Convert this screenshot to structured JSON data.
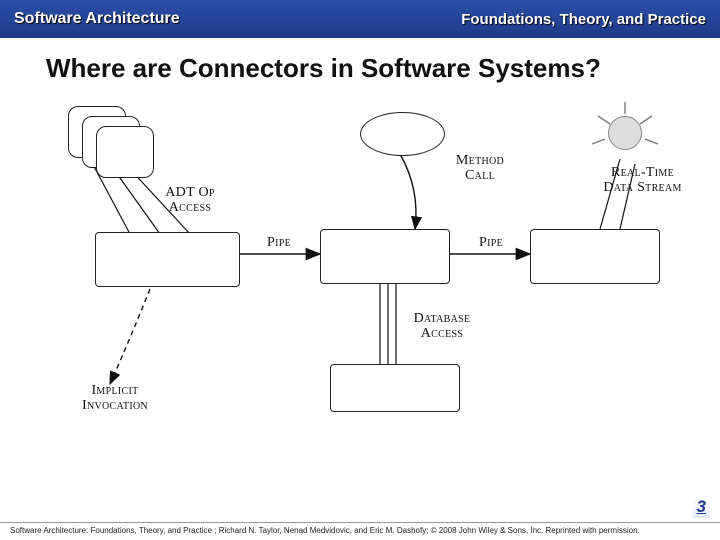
{
  "header": {
    "left": "Software Architecture",
    "right": "Foundations, Theory, and Practice"
  },
  "title": "Where are Connectors in Software Systems?",
  "labels": {
    "adt": "ADT Op Access",
    "pipe1": "Pipe",
    "pipe2": "Pipe",
    "method": "Method Call",
    "realtime": "Real-Time Data Stream",
    "implicit": "Implicit Invocation",
    "database": "Database Access"
  },
  "page_number": "3",
  "footer": "Software Architecture: Foundations, Theory, and Practice ; Richard N. Taylor, Nenad Medvidovic, and Eric M. Dashofy; © 2008 John Wiley & Sons, Inc. Reprinted with permission."
}
